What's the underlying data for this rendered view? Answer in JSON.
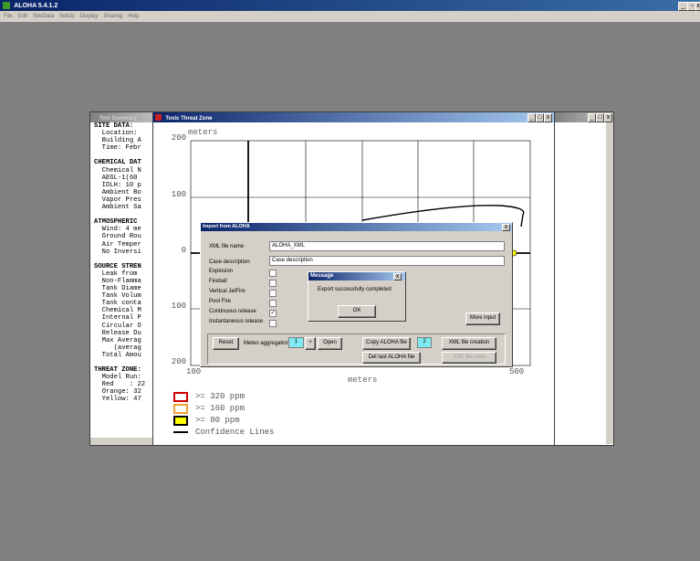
{
  "app": {
    "title": "ALOHA 5.4.1.2",
    "menu": [
      "File",
      "Edit",
      "SiteData",
      "SetUp",
      "Display",
      "Sharing",
      "Help"
    ]
  },
  "text_summary": {
    "title": "Text Summary",
    "lines": [
      {
        "t": "SITE DATA:",
        "bold": true
      },
      {
        "t": "  Location:"
      },
      {
        "t": "  Building A"
      },
      {
        "t": "  Time: Febr"
      },
      {
        "t": ""
      },
      {
        "t": "CHEMICAL DAT",
        "bold": true
      },
      {
        "t": "  Chemical N"
      },
      {
        "t": "  AEGL-1(60"
      },
      {
        "t": "  IDLH: 10 p"
      },
      {
        "t": "  Ambient Bo"
      },
      {
        "t": "  Vapor Pres"
      },
      {
        "t": "  Ambient Sa"
      },
      {
        "t": ""
      },
      {
        "t": "ATMOSPHERIC",
        "bold": true
      },
      {
        "t": "  Wind: 4 me"
      },
      {
        "t": "  Ground Rou"
      },
      {
        "t": "  Air Temper"
      },
      {
        "t": "  No Inversi"
      },
      {
        "t": ""
      },
      {
        "t": "SOURCE STREN",
        "bold": true
      },
      {
        "t": "  Leak from"
      },
      {
        "t": "  Non-Flamma"
      },
      {
        "t": "  Tank Diame"
      },
      {
        "t": "  Tank Volum"
      },
      {
        "t": "  Tank conta"
      },
      {
        "t": "  Chemical M"
      },
      {
        "t": "  Internal P"
      },
      {
        "t": "  Circular O"
      },
      {
        "t": "  Release Du"
      },
      {
        "t": "  Max Averag"
      },
      {
        "t": "     (averag"
      },
      {
        "t": "  Total Amou"
      },
      {
        "t": ""
      },
      {
        "t": "THREAT ZONE:",
        "bold": true
      },
      {
        "t": "  Model Run:"
      },
      {
        "t": "  Red    : 22"
      },
      {
        "t": "  Orange: 32"
      },
      {
        "t": "  Yellow: 47"
      }
    ]
  },
  "threat_zone": {
    "title": "Toxic Threat Zone",
    "y_unit": "meters",
    "x_unit": "meters",
    "y_ticks": [
      "200",
      "100",
      "0",
      "100",
      "200"
    ],
    "x_ticks": [
      "100",
      "500"
    ],
    "legend": [
      {
        "label": ">= 320 ppm",
        "color": "#ffffff",
        "border": "#cc0000"
      },
      {
        "label": ">= 160 ppm",
        "color": "#ffffff",
        "border": "#f0a030"
      },
      {
        "label": ">= 80 ppm",
        "color": "#ffff00",
        "border": "#000000"
      },
      {
        "label": "Confidence Lines",
        "line": true
      }
    ]
  },
  "import_dialog": {
    "title": "Import from ALOHA",
    "xml_file_label": "XML file name",
    "xml_file_value": "ALOHA_XML",
    "case_desc_label": "Case description",
    "case_desc_value": "Case description",
    "checks": [
      {
        "label": "Explosion",
        "checked": false
      },
      {
        "label": "Fireball",
        "checked": false
      },
      {
        "label": "Vertical JetFire",
        "checked": false
      },
      {
        "label": "Pool Fire",
        "checked": false
      },
      {
        "label": "Continuous release",
        "checked": true
      },
      {
        "label": "Instantaneous release",
        "checked": false
      }
    ],
    "more_input": "More input",
    "reset": "Reset",
    "meteo_label": "Meteo aggregation",
    "meteo_value": "1",
    "meteo_btn": "+",
    "open": "Open",
    "copy_aloha": "Copy ALOHA file",
    "copy_value": "2",
    "xml_creation": "XML file creation",
    "del_aloha": "Del last ALOHA file",
    "xml_view": "XML file view"
  },
  "message": {
    "title": "Message",
    "text": "Export successfully completed",
    "ok": "OK"
  },
  "window_caps": {
    "min": "_",
    "max": "□",
    "close": "x"
  }
}
